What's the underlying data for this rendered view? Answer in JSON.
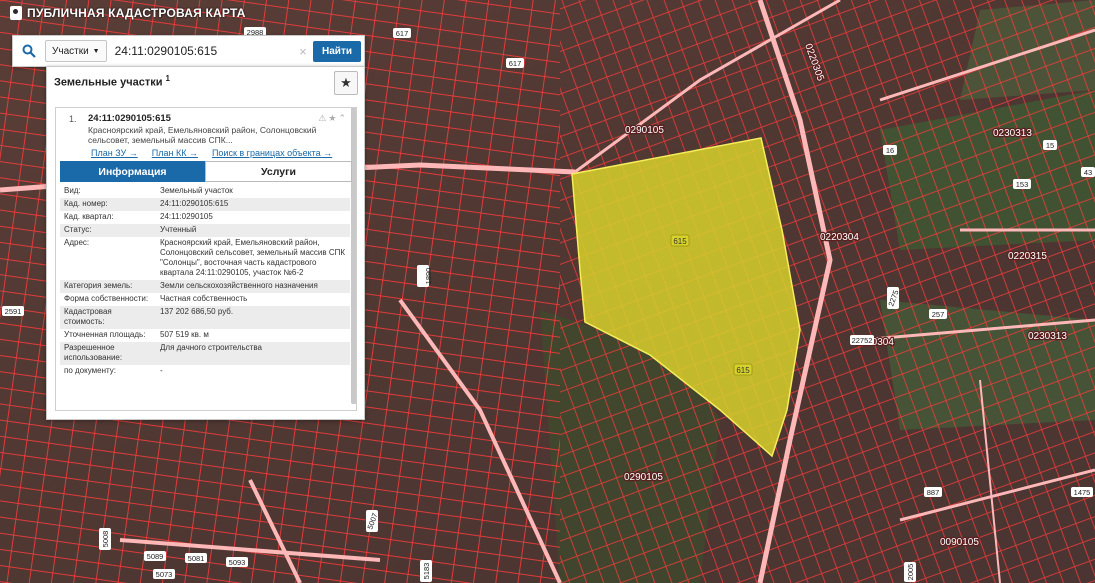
{
  "app": {
    "title": "ПУБЛИЧНАЯ КАДАСТРОВАЯ КАРТА"
  },
  "search": {
    "type_label": "Участки",
    "query": "24:11:0290105:615",
    "clear_symbol": "×",
    "button_label": "Найти"
  },
  "panel": {
    "title": "Земельные участки",
    "count": "1"
  },
  "result": {
    "index": "1.",
    "cad_number": "24:11:0290105:615",
    "address_short": "Красноярский край, Емельяновский район, Солонцовский сельсовет, земельный массив СПК...",
    "links": [
      "План ЗУ →",
      "План КК →",
      "Поиск в границах объекта →"
    ]
  },
  "tabs": [
    "Информация",
    "Услуги"
  ],
  "info": [
    {
      "key": "Вид:",
      "value": "Земельный участок"
    },
    {
      "key": "Кад. номер:",
      "value": "24:11:0290105:615"
    },
    {
      "key": "Кад. квартал:",
      "value": "24:11:0290105"
    },
    {
      "key": "Статус:",
      "value": "Учтенный"
    },
    {
      "key": "Адрес:",
      "value": "Красноярский край, Емельяновский район, Солонцовский сельсовет, земельный массив СПК \"Солонцы\", восточная часть кадастрового квартала 24:11:0290105, участок №6-2"
    },
    {
      "key": "Категория земель:",
      "value": "Земли сельскохозяйственного назначения"
    },
    {
      "key": "Форма собственности:",
      "value": "Частная собственность"
    },
    {
      "key": "Кадастровая стоимость:",
      "value": "137 202 686,50 руб."
    },
    {
      "key": "Уточненная площадь:",
      "value": "507 519 кв. м"
    },
    {
      "key": "Разрешенное использование:",
      "value": "Для дачного строительства"
    },
    {
      "key": "по документу:",
      "value": "-"
    }
  ],
  "map_labels": {
    "parcel_center": "615",
    "parcel_south": "615",
    "l617a": "617",
    "l617b": "617",
    "q0290105a": "0290105",
    "q0290105b": "0290105",
    "q0220304a": "0220304",
    "q0220304b": "0220304",
    "q0220315": "0220315",
    "q0230313a": "0230313",
    "q0230313b": "0230313",
    "q0090105": "0090105",
    "q0220305": "0220305",
    "l2988": "2988",
    "l1890": "1890",
    "l2591": "2591",
    "l5089": "5089",
    "l5081": "5081",
    "l5093": "5093",
    "l5073": "5073",
    "l5007": "5007",
    "l5008": "5008",
    "l2275": "2275",
    "l22752": "22752",
    "l257": "257",
    "l153": "153",
    "l16": "16",
    "l15": "15",
    "l887": "887",
    "l1475": "1475",
    "l43": "43",
    "l5183": "5183",
    "l2005": "2005"
  },
  "colors": {
    "accent": "#1a69a8",
    "parcel_outline": "#ff2a2a",
    "selected_fill": "#d7d12b"
  }
}
